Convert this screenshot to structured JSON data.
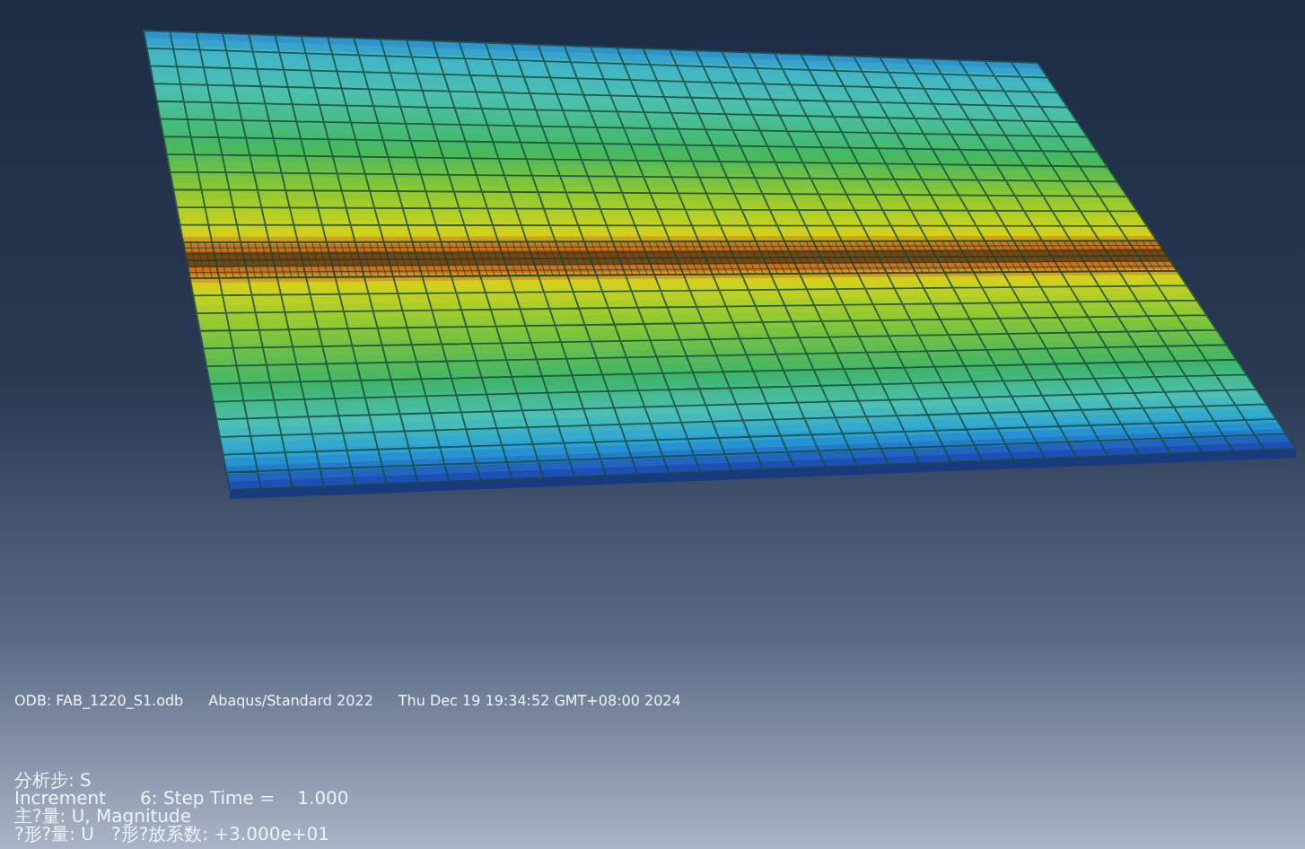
{
  "viewport": {
    "header": {
      "odb": "ODB: FAB_1220_S1.odb",
      "solver": "Abaqus/Standard 2022",
      "timestamp": "Thu Dec 19 19:34:52 GMT+08:00 2024"
    },
    "state_block": [
      "分析步: S",
      "Increment      6: Step Time =    1.000",
      "主?量: U, Magnitude",
      "?形?量: U   ?形?放系数: +3.000e+01"
    ]
  }
}
